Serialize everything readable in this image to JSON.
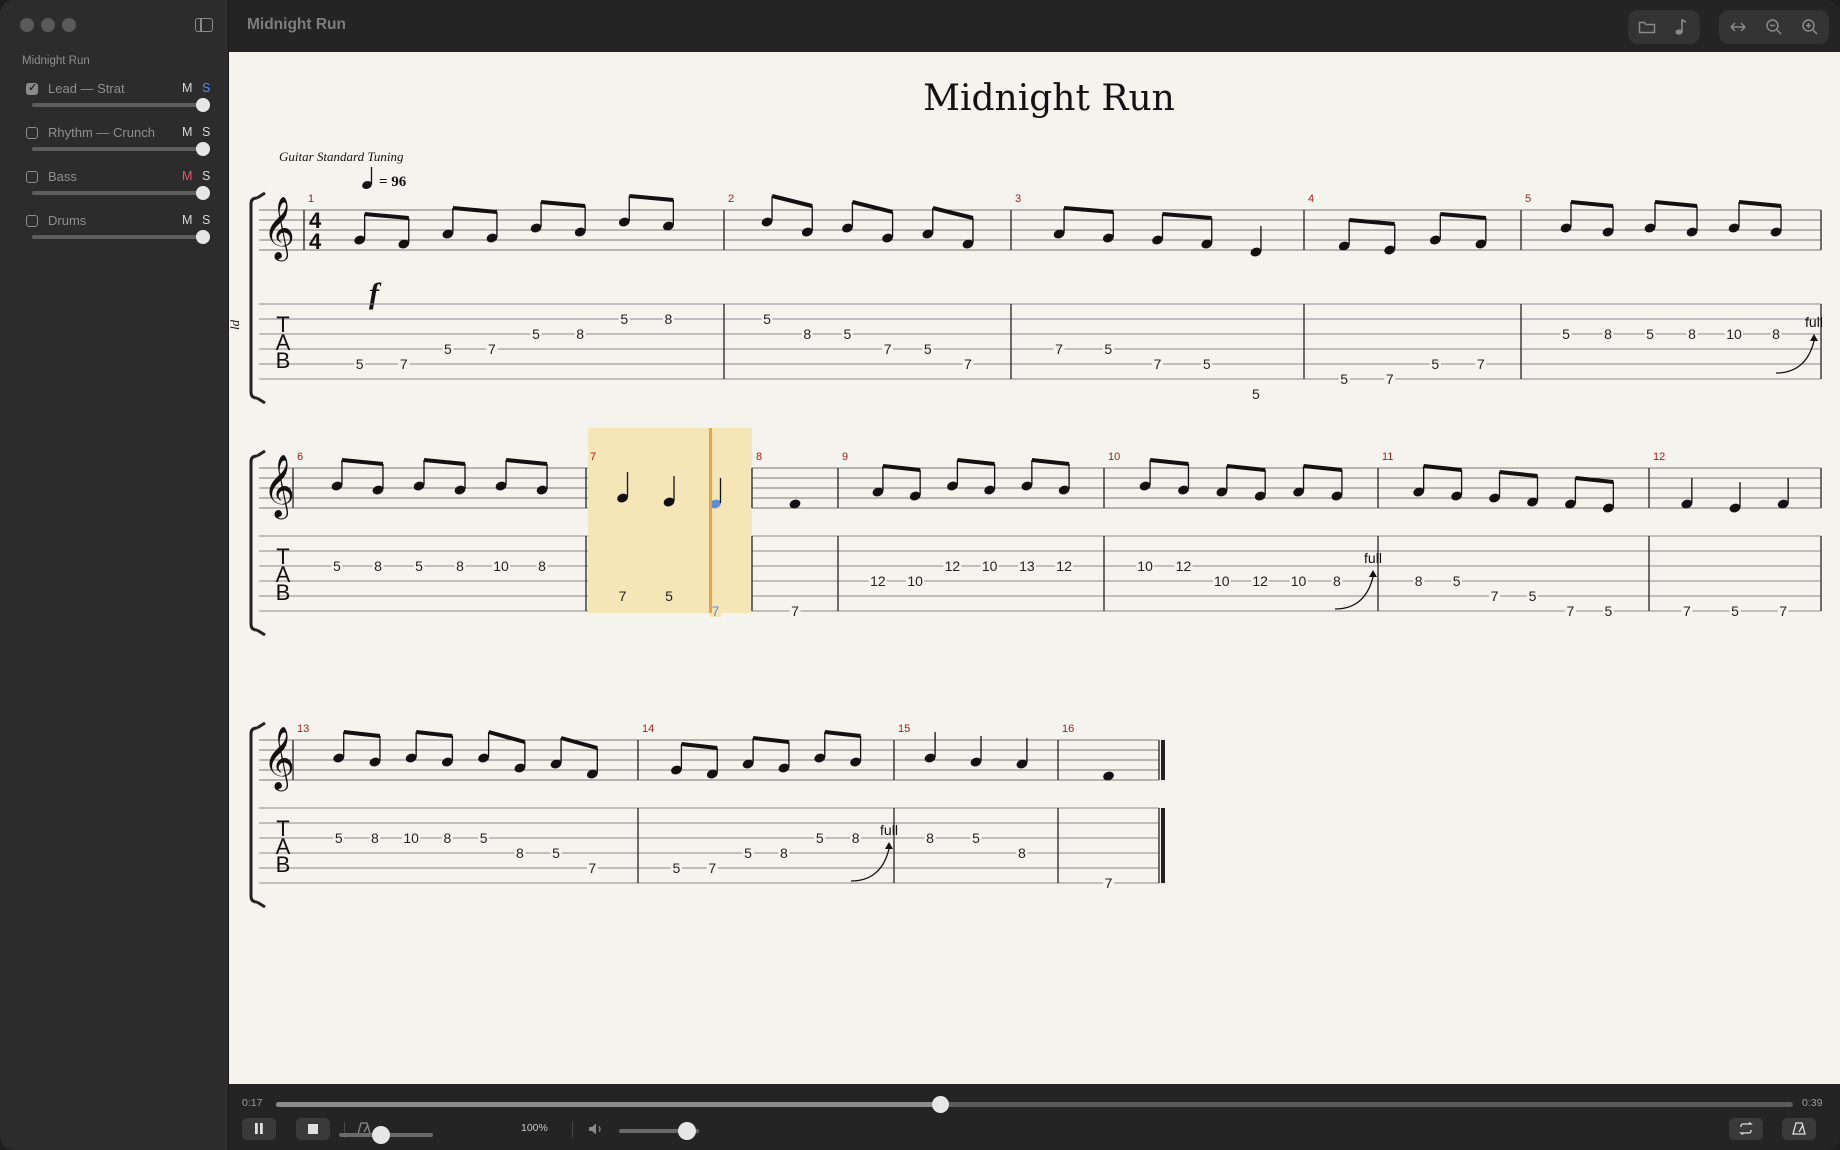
{
  "window": {
    "title": "Midnight Run"
  },
  "sidebar": {
    "song": "Midnight Run",
    "tracks": [
      {
        "name": "Lead — Strat",
        "checked": true,
        "mute": "M",
        "solo": "S",
        "mute_color": "#d9d9d9",
        "solo_color": "#4d8ef7"
      },
      {
        "name": "Rhythm — Crunch",
        "checked": false,
        "mute": "M",
        "solo": "S",
        "mute_color": "#d9d9d9",
        "solo_color": "#d9d9d9"
      },
      {
        "name": "Bass",
        "checked": false,
        "mute": "M",
        "solo": "S",
        "mute_color": "#f0556a",
        "solo_color": "#d9d9d9"
      },
      {
        "name": "Drums",
        "checked": false,
        "mute": "M",
        "solo": "S",
        "mute_color": "#d9d9d9",
        "solo_color": "#d9d9d9"
      }
    ]
  },
  "score": {
    "title": "Midnight Run",
    "tuning": "Guitar Standard Tuning",
    "tempo": "= 96",
    "dynamic": "f",
    "track_abbrev": "ld",
    "tab_label": [
      "T",
      "A",
      "B"
    ],
    "bend_label": "full",
    "colors": {
      "measure_number": "#b01818",
      "selection": "#f5e6b8",
      "cursor": "#f0a03c",
      "cursor_note": "#5b8fd6"
    },
    "systems": [
      {
        "time_sig": "44",
        "measures": [
          {
            "n": "1",
            "notes": [
              {
                "s": 5,
                "f": "5"
              },
              {
                "s": 5,
                "f": "7"
              },
              {
                "s": 4,
                "f": "5"
              },
              {
                "s": 4,
                "f": "7"
              },
              {
                "s": 3,
                "f": "5"
              },
              {
                "s": 3,
                "f": "8"
              },
              {
                "s": 2,
                "f": "5"
              },
              {
                "s": 2,
                "f": "8"
              }
            ]
          },
          {
            "n": "2",
            "notes": [
              {
                "s": 2,
                "f": "5"
              },
              {
                "s": 3,
                "f": "8"
              },
              {
                "s": 3,
                "f": "5"
              },
              {
                "s": 4,
                "f": "7"
              },
              {
                "s": 4,
                "f": "5"
              },
              {
                "s": 5,
                "f": "7"
              }
            ]
          },
          {
            "n": "3",
            "notes": [
              {
                "s": 4,
                "f": "7"
              },
              {
                "s": 4,
                "f": "5"
              },
              {
                "s": 5,
                "f": "7"
              },
              {
                "s": 5,
                "f": "5"
              },
              {
                "s": 7,
                "f": "5"
              }
            ]
          },
          {
            "n": "4",
            "notes": [
              {
                "s": 6,
                "f": "5"
              },
              {
                "s": 6,
                "f": "7"
              },
              {
                "s": 5,
                "f": "5"
              },
              {
                "s": 5,
                "f": "7"
              }
            ]
          },
          {
            "n": "5",
            "notes": [
              {
                "s": 3,
                "f": "5"
              },
              {
                "s": 3,
                "f": "8"
              },
              {
                "s": 3,
                "f": "5"
              },
              {
                "s": 3,
                "f": "8"
              },
              {
                "s": 3,
                "f": "10"
              },
              {
                "s": 3,
                "f": "8"
              }
            ]
          }
        ]
      },
      {
        "measures": [
          {
            "n": "6",
            "notes": [
              {
                "s": 3,
                "f": "5"
              },
              {
                "s": 3,
                "f": "8"
              },
              {
                "s": 3,
                "f": "5"
              },
              {
                "s": 3,
                "f": "8"
              },
              {
                "s": 3,
                "f": "10"
              },
              {
                "s": 3,
                "f": "8"
              }
            ]
          },
          {
            "n": "7",
            "notes": [
              {
                "s": 5,
                "f": "7"
              },
              {
                "s": 5,
                "f": "5"
              },
              {
                "s": 6,
                "f": "7"
              }
            ]
          },
          {
            "n": "8",
            "notes": [
              {
                "s": 6,
                "f": "7"
              }
            ]
          },
          {
            "n": "9",
            "notes": [
              {
                "s": 4,
                "f": "12"
              },
              {
                "s": 4,
                "f": "10"
              },
              {
                "s": 3,
                "f": "12"
              },
              {
                "s": 3,
                "f": "10"
              },
              {
                "s": 3,
                "f": "13"
              },
              {
                "s": 3,
                "f": "12"
              }
            ]
          },
          {
            "n": "10",
            "notes": [
              {
                "s": 3,
                "f": "10"
              },
              {
                "s": 3,
                "f": "12"
              },
              {
                "s": 4,
                "f": "10"
              },
              {
                "s": 4,
                "f": "12"
              },
              {
                "s": 4,
                "f": "10"
              },
              {
                "s": 4,
                "f": "8"
              }
            ]
          },
          {
            "n": "11",
            "notes": [
              {
                "s": 4,
                "f": "8"
              },
              {
                "s": 4,
                "f": "5"
              },
              {
                "s": 5,
                "f": "7"
              },
              {
                "s": 5,
                "f": "5"
              },
              {
                "s": 6,
                "f": "7"
              },
              {
                "s": 6,
                "f": "5"
              }
            ]
          },
          {
            "n": "12",
            "notes": [
              {
                "s": 6,
                "f": "7"
              },
              {
                "s": 6,
                "f": "5"
              },
              {
                "s": 6,
                "f": "7"
              }
            ]
          }
        ]
      },
      {
        "measures": [
          {
            "n": "13",
            "notes": [
              {
                "s": 3,
                "f": "5"
              },
              {
                "s": 3,
                "f": "8"
              },
              {
                "s": 3,
                "f": "10"
              },
              {
                "s": 3,
                "f": "8"
              },
              {
                "s": 3,
                "f": "5"
              },
              {
                "s": 4,
                "f": "8"
              },
              {
                "s": 4,
                "f": "5"
              },
              {
                "s": 5,
                "f": "7"
              }
            ]
          },
          {
            "n": "14",
            "notes": [
              {
                "s": 5,
                "f": "5"
              },
              {
                "s": 5,
                "f": "7"
              },
              {
                "s": 4,
                "f": "5"
              },
              {
                "s": 4,
                "f": "8"
              },
              {
                "s": 3,
                "f": "5"
              },
              {
                "s": 3,
                "f": "8"
              }
            ]
          },
          {
            "n": "15",
            "notes": [
              {
                "s": 3,
                "f": "8"
              },
              {
                "s": 3,
                "f": "5"
              },
              {
                "s": 4,
                "f": "8"
              }
            ]
          },
          {
            "n": "16",
            "notes": [
              {
                "s": 6,
                "f": "7"
              }
            ]
          }
        ]
      }
    ]
  },
  "transport": {
    "elapsed": "0:17",
    "total": "0:39",
    "progress": 0.438,
    "speed": "100%",
    "speed_level": 0.45,
    "volume_level": 0.85
  }
}
